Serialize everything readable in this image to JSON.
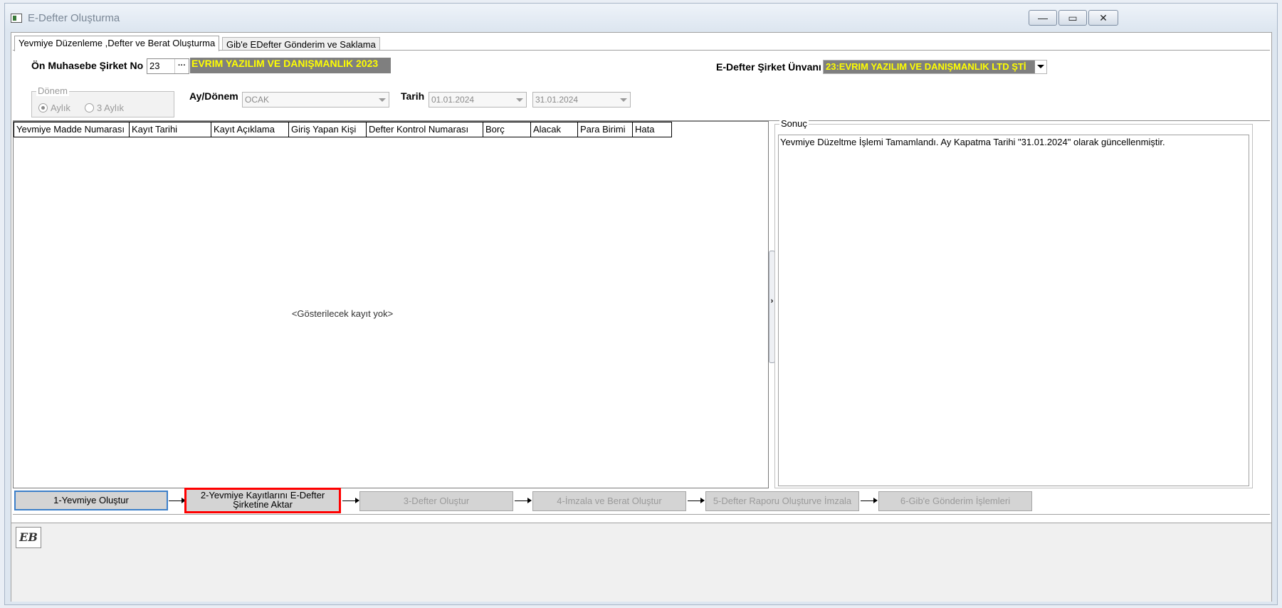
{
  "window": {
    "title": "E-Defter Oluşturma",
    "minimize": "—",
    "maximize": "▭",
    "close": "✕"
  },
  "tabs": [
    "Yevmiye Düzenleme ,Defter ve Berat Oluşturma",
    "Gib'e EDefter Gönderim ve Saklama"
  ],
  "form": {
    "on_muhasebe_label": "Ön Muhasebe Şirket No",
    "on_muhasebe_value": "23",
    "lookup_btn": "···",
    "company_name": "EVRIM YAZILIM  VE DANIŞMANLIK 2023",
    "edefter_label": "E-Defter Şirket Ünvanı",
    "edefter_value": "23:EVRIM YAZILIM VE DANIŞMANLIK LTD ŞTİ",
    "donem_title": "Dönem",
    "donem_options": [
      "Aylık",
      "3 Aylık"
    ],
    "ay_donem_label": "Ay/Dönem",
    "ay_donem_value": "OCAK",
    "tarih_label": "Tarih",
    "tarih_start": "01.01.2024",
    "tarih_end": "31.01.2024"
  },
  "grid": {
    "columns": [
      "Yevmiye Madde Numarası",
      "Kayıt Tarihi",
      "Kayıt Açıklama",
      "Giriş Yapan Kişi",
      "Defter Kontrol Numarası",
      "Borç",
      "Alacak",
      "Para Birimi",
      "Hata"
    ],
    "empty_message": "<Gösterilecek kayıt yok>"
  },
  "splitter_glyph": "›",
  "result": {
    "title": "Sonuç",
    "text": "Yevmiye Düzeltme İşlemi Tamamlandı. Ay Kapatma Tarihi \"31.01.2024\" olarak güncellenmiştir."
  },
  "steps": [
    "1-Yevmiye Oluştur",
    "2-Yevmiye Kayıtlarını E-Defter Şirketine Aktar",
    "3-Defter Oluştur",
    "4-İmzala ve Berat Oluştur",
    "5-Defter Raporu Oluşturve İmzala",
    "6-Gib'e Gönderim İşlemleri"
  ],
  "logo_text": "EB"
}
